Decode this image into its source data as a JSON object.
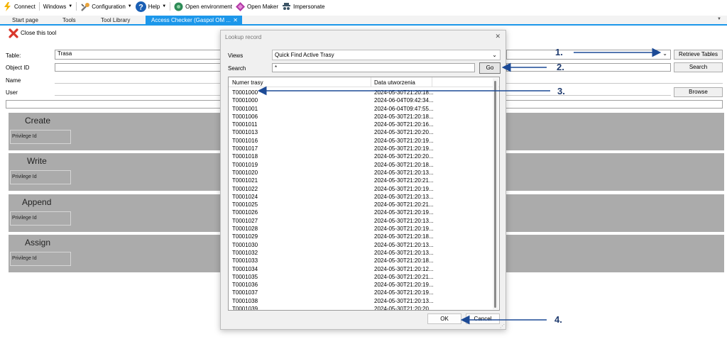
{
  "toolbar": {
    "connect": "Connect",
    "windows": "Windows",
    "configuration": "Configuration",
    "help": "Help",
    "open_environment": "Open environment",
    "open_maker": "Open Maker",
    "impersonate": "Impersonate"
  },
  "tabs": [
    {
      "label": "Start page"
    },
    {
      "label": "Tools"
    },
    {
      "label": "Tool Library"
    },
    {
      "label": "Access Checker (Gaspol OM ..."
    }
  ],
  "tool": {
    "close_label": "Close this tool",
    "table_label": "Table:",
    "table_value": "Trasa",
    "object_id_label": "Object ID",
    "name_label": "Name",
    "user_label": "User",
    "retrieve_tables": "Retrieve Tables",
    "search": "Search",
    "browse": "Browse",
    "privileges": [
      {
        "title": "Create",
        "id_label": "Privilege Id"
      },
      {
        "title": "Write",
        "id_label": "Privilege Id"
      },
      {
        "title": "Append",
        "id_label": "Privilege Id"
      },
      {
        "title": "Assign",
        "id_label": "Privilege Id"
      }
    ]
  },
  "dialog": {
    "title": "Lookup record",
    "views_label": "Views",
    "views_value": "Quick Find Active Trasy",
    "search_label": "Search",
    "search_value": "*",
    "go": "Go",
    "columns": [
      "Numer trasy",
      "Data utworzenia"
    ],
    "rows": [
      [
        "T0001000",
        "2024-05-30T21:20:18..."
      ],
      [
        "T0001000",
        "2024-06-04T09:42:34..."
      ],
      [
        "T0001001",
        "2024-06-04T09:47:55..."
      ],
      [
        "T0001006",
        "2024-05-30T21:20:18..."
      ],
      [
        "T0001011",
        "2024-05-30T21:20:16..."
      ],
      [
        "T0001013",
        "2024-05-30T21:20:20..."
      ],
      [
        "T0001016",
        "2024-05-30T21:20:19..."
      ],
      [
        "T0001017",
        "2024-05-30T21:20:19..."
      ],
      [
        "T0001018",
        "2024-05-30T21:20:20..."
      ],
      [
        "T0001019",
        "2024-05-30T21:20:18..."
      ],
      [
        "T0001020",
        "2024-05-30T21:20:13..."
      ],
      [
        "T0001021",
        "2024-05-30T21:20:21..."
      ],
      [
        "T0001022",
        "2024-05-30T21:20:19..."
      ],
      [
        "T0001024",
        "2024-05-30T21:20:13..."
      ],
      [
        "T0001025",
        "2024-05-30T21:20:21..."
      ],
      [
        "T0001026",
        "2024-05-30T21:20:19..."
      ],
      [
        "T0001027",
        "2024-05-30T21:20:13..."
      ],
      [
        "T0001028",
        "2024-05-30T21:20:19..."
      ],
      [
        "T0001029",
        "2024-05-30T21:20:18..."
      ],
      [
        "T0001030",
        "2024-05-30T21:20:13..."
      ],
      [
        "T0001032",
        "2024-05-30T21:20:13..."
      ],
      [
        "T0001033",
        "2024-05-30T21:20:18..."
      ],
      [
        "T0001034",
        "2024-05-30T21:20:12..."
      ],
      [
        "T0001035",
        "2024-05-30T21:20:21..."
      ],
      [
        "T0001036",
        "2024-05-30T21:20:19..."
      ],
      [
        "T0001037",
        "2024-05-30T21:20:19..."
      ],
      [
        "T0001038",
        "2024-05-30T21:20:13..."
      ],
      [
        "T0001039",
        "2024-05-30T21:20:20..."
      ]
    ],
    "ok": "OK",
    "cancel": "Cancel"
  },
  "annotations": [
    "1.",
    "2.",
    "3.",
    "4."
  ],
  "colors": {
    "accent": "#1c97ea",
    "annotation": "#1f3b6f",
    "privilege_block": "#ababab"
  }
}
